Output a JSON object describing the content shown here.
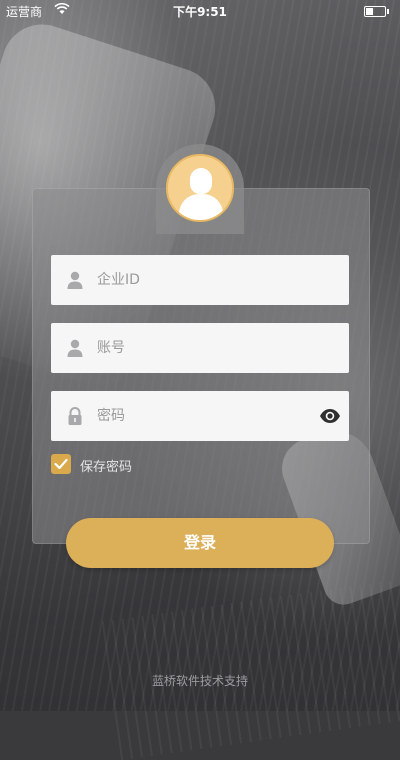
{
  "status_bar": {
    "carrier": "运营商",
    "time": "下午9:51"
  },
  "form": {
    "company_id_placeholder": "企业ID",
    "account_placeholder": "账号",
    "password_placeholder": "密码",
    "remember_label": "保存密码",
    "remember_checked": true
  },
  "login_button": "登录",
  "footer": "蓝桥软件技术支持",
  "colors": {
    "accent": "#dcb059",
    "avatar_bg": "#f5d08e",
    "checkbox": "#d9a94c"
  },
  "icons": {
    "company_id": "user-icon",
    "account": "user-icon",
    "password": "lock-icon",
    "show_password": "eye-icon",
    "avatar": "avatar-icon",
    "checkmark": "check-icon"
  }
}
